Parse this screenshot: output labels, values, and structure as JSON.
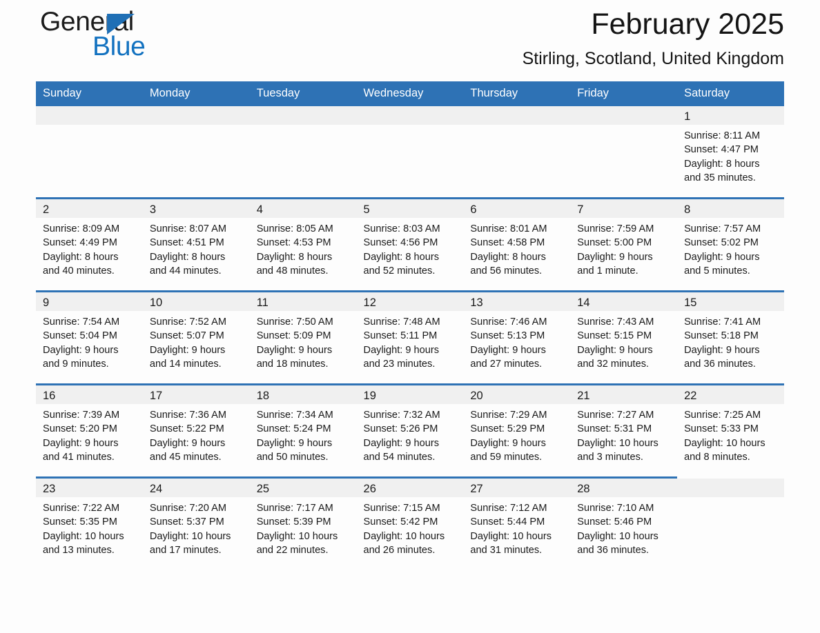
{
  "brand": {
    "word1": "General",
    "word2": "Blue",
    "triangle_icon": "triangle-icon",
    "accent_color": "#1372c0"
  },
  "header": {
    "month_title": "February 2025",
    "location": "Stirling, Scotland, United Kingdom"
  },
  "theme": {
    "header_blue": "#2e72b5",
    "daynum_band": "#f0f0f0",
    "page_bg": "#fdfdfd"
  },
  "weekday_headers": [
    "Sunday",
    "Monday",
    "Tuesday",
    "Wednesday",
    "Thursday",
    "Friday",
    "Saturday"
  ],
  "labels": {
    "sunrise_prefix": "Sunrise:",
    "sunset_prefix": "Sunset:",
    "daylight_prefix": "Daylight:"
  },
  "weeks": [
    [
      {
        "empty": true
      },
      {
        "empty": true
      },
      {
        "empty": true
      },
      {
        "empty": true
      },
      {
        "empty": true
      },
      {
        "empty": true
      },
      {
        "day": "1",
        "sunrise": "Sunrise: 8:11 AM",
        "sunset": "Sunset: 4:47 PM",
        "daylight_line1": "Daylight: 8 hours",
        "daylight_line2": "and 35 minutes."
      }
    ],
    [
      {
        "day": "2",
        "sunrise": "Sunrise: 8:09 AM",
        "sunset": "Sunset: 4:49 PM",
        "daylight_line1": "Daylight: 8 hours",
        "daylight_line2": "and 40 minutes."
      },
      {
        "day": "3",
        "sunrise": "Sunrise: 8:07 AM",
        "sunset": "Sunset: 4:51 PM",
        "daylight_line1": "Daylight: 8 hours",
        "daylight_line2": "and 44 minutes."
      },
      {
        "day": "4",
        "sunrise": "Sunrise: 8:05 AM",
        "sunset": "Sunset: 4:53 PM",
        "daylight_line1": "Daylight: 8 hours",
        "daylight_line2": "and 48 minutes."
      },
      {
        "day": "5",
        "sunrise": "Sunrise: 8:03 AM",
        "sunset": "Sunset: 4:56 PM",
        "daylight_line1": "Daylight: 8 hours",
        "daylight_line2": "and 52 minutes."
      },
      {
        "day": "6",
        "sunrise": "Sunrise: 8:01 AM",
        "sunset": "Sunset: 4:58 PM",
        "daylight_line1": "Daylight: 8 hours",
        "daylight_line2": "and 56 minutes."
      },
      {
        "day": "7",
        "sunrise": "Sunrise: 7:59 AM",
        "sunset": "Sunset: 5:00 PM",
        "daylight_line1": "Daylight: 9 hours",
        "daylight_line2": "and 1 minute."
      },
      {
        "day": "8",
        "sunrise": "Sunrise: 7:57 AM",
        "sunset": "Sunset: 5:02 PM",
        "daylight_line1": "Daylight: 9 hours",
        "daylight_line2": "and 5 minutes."
      }
    ],
    [
      {
        "day": "9",
        "sunrise": "Sunrise: 7:54 AM",
        "sunset": "Sunset: 5:04 PM",
        "daylight_line1": "Daylight: 9 hours",
        "daylight_line2": "and 9 minutes."
      },
      {
        "day": "10",
        "sunrise": "Sunrise: 7:52 AM",
        "sunset": "Sunset: 5:07 PM",
        "daylight_line1": "Daylight: 9 hours",
        "daylight_line2": "and 14 minutes."
      },
      {
        "day": "11",
        "sunrise": "Sunrise: 7:50 AM",
        "sunset": "Sunset: 5:09 PM",
        "daylight_line1": "Daylight: 9 hours",
        "daylight_line2": "and 18 minutes."
      },
      {
        "day": "12",
        "sunrise": "Sunrise: 7:48 AM",
        "sunset": "Sunset: 5:11 PM",
        "daylight_line1": "Daylight: 9 hours",
        "daylight_line2": "and 23 minutes."
      },
      {
        "day": "13",
        "sunrise": "Sunrise: 7:46 AM",
        "sunset": "Sunset: 5:13 PM",
        "daylight_line1": "Daylight: 9 hours",
        "daylight_line2": "and 27 minutes."
      },
      {
        "day": "14",
        "sunrise": "Sunrise: 7:43 AM",
        "sunset": "Sunset: 5:15 PM",
        "daylight_line1": "Daylight: 9 hours",
        "daylight_line2": "and 32 minutes."
      },
      {
        "day": "15",
        "sunrise": "Sunrise: 7:41 AM",
        "sunset": "Sunset: 5:18 PM",
        "daylight_line1": "Daylight: 9 hours",
        "daylight_line2": "and 36 minutes."
      }
    ],
    [
      {
        "day": "16",
        "sunrise": "Sunrise: 7:39 AM",
        "sunset": "Sunset: 5:20 PM",
        "daylight_line1": "Daylight: 9 hours",
        "daylight_line2": "and 41 minutes."
      },
      {
        "day": "17",
        "sunrise": "Sunrise: 7:36 AM",
        "sunset": "Sunset: 5:22 PM",
        "daylight_line1": "Daylight: 9 hours",
        "daylight_line2": "and 45 minutes."
      },
      {
        "day": "18",
        "sunrise": "Sunrise: 7:34 AM",
        "sunset": "Sunset: 5:24 PM",
        "daylight_line1": "Daylight: 9 hours",
        "daylight_line2": "and 50 minutes."
      },
      {
        "day": "19",
        "sunrise": "Sunrise: 7:32 AM",
        "sunset": "Sunset: 5:26 PM",
        "daylight_line1": "Daylight: 9 hours",
        "daylight_line2": "and 54 minutes."
      },
      {
        "day": "20",
        "sunrise": "Sunrise: 7:29 AM",
        "sunset": "Sunset: 5:29 PM",
        "daylight_line1": "Daylight: 9 hours",
        "daylight_line2": "and 59 minutes."
      },
      {
        "day": "21",
        "sunrise": "Sunrise: 7:27 AM",
        "sunset": "Sunset: 5:31 PM",
        "daylight_line1": "Daylight: 10 hours",
        "daylight_line2": "and 3 minutes."
      },
      {
        "day": "22",
        "sunrise": "Sunrise: 7:25 AM",
        "sunset": "Sunset: 5:33 PM",
        "daylight_line1": "Daylight: 10 hours",
        "daylight_line2": "and 8 minutes."
      }
    ],
    [
      {
        "day": "23",
        "sunrise": "Sunrise: 7:22 AM",
        "sunset": "Sunset: 5:35 PM",
        "daylight_line1": "Daylight: 10 hours",
        "daylight_line2": "and 13 minutes."
      },
      {
        "day": "24",
        "sunrise": "Sunrise: 7:20 AM",
        "sunset": "Sunset: 5:37 PM",
        "daylight_line1": "Daylight: 10 hours",
        "daylight_line2": "and 17 minutes."
      },
      {
        "day": "25",
        "sunrise": "Sunrise: 7:17 AM",
        "sunset": "Sunset: 5:39 PM",
        "daylight_line1": "Daylight: 10 hours",
        "daylight_line2": "and 22 minutes."
      },
      {
        "day": "26",
        "sunrise": "Sunrise: 7:15 AM",
        "sunset": "Sunset: 5:42 PM",
        "daylight_line1": "Daylight: 10 hours",
        "daylight_line2": "and 26 minutes."
      },
      {
        "day": "27",
        "sunrise": "Sunrise: 7:12 AM",
        "sunset": "Sunset: 5:44 PM",
        "daylight_line1": "Daylight: 10 hours",
        "daylight_line2": "and 31 minutes."
      },
      {
        "day": "28",
        "sunrise": "Sunrise: 7:10 AM",
        "sunset": "Sunset: 5:46 PM",
        "daylight_line1": "Daylight: 10 hours",
        "daylight_line2": "and 36 minutes."
      },
      {
        "empty": true
      }
    ]
  ]
}
